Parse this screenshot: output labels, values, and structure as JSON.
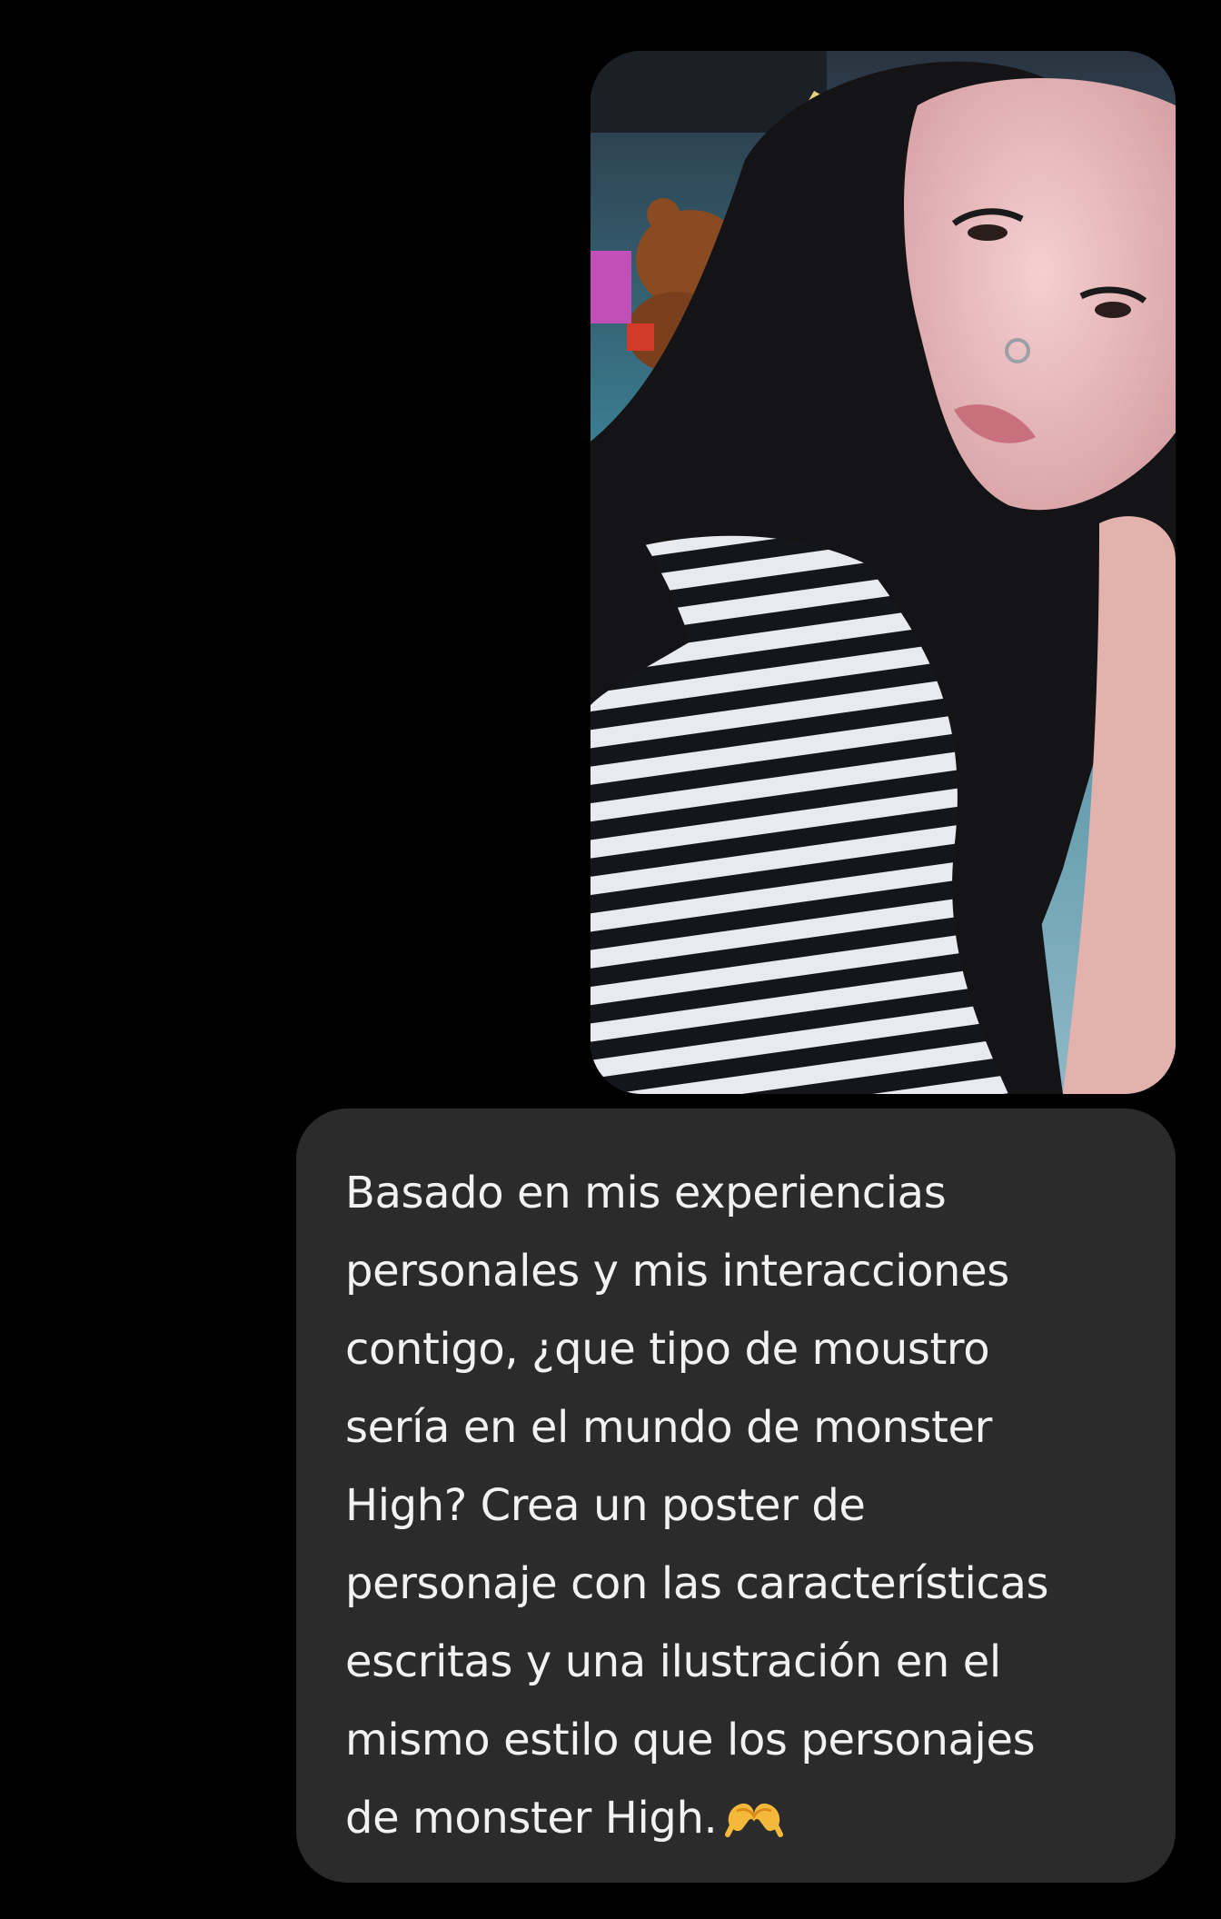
{
  "conversation": {
    "messages": [
      {
        "type": "image",
        "sender": "user",
        "image_icon": "selfie-photo"
      },
      {
        "type": "text",
        "sender": "user",
        "text": "Basado en mis experiencias\npersonales y mis interacciones\ncontigo, ¿que tipo de moustro\nsería en el mundo de monster\nHigh? Crea un poster de\npersonaje con las características\nescritas y una ilustración en el\nmismo estilo que los personajes\nde monster High.",
        "emoji_icon": "heart-hands-icon"
      }
    ]
  },
  "colors": {
    "background": "#000000",
    "bubble": "#2b2b2b",
    "bubble_text": "#f2f2f2"
  }
}
